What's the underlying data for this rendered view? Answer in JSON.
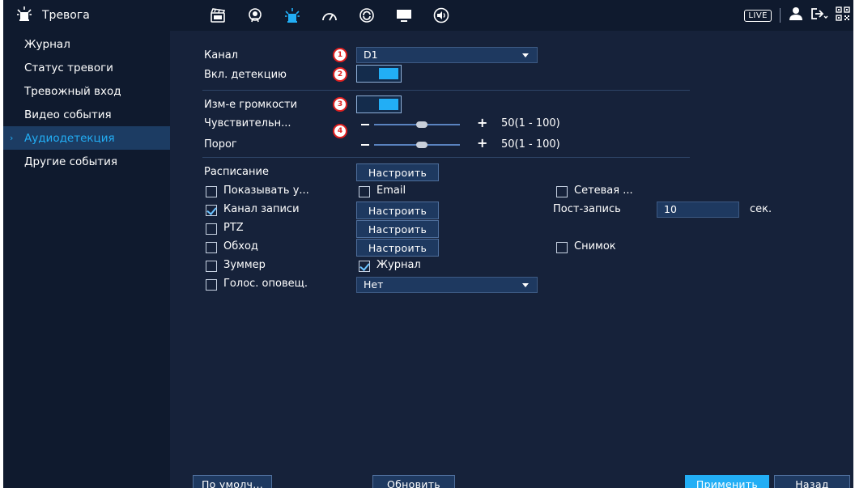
{
  "header": {
    "title": "Тревога",
    "live_label": "LIVE",
    "icons": [
      "alarm-light-icon",
      "film-icon",
      "face-ai-icon",
      "alarm-icon",
      "gauge-icon",
      "refresh-icon",
      "monitor-icon",
      "speaker-icon",
      "user-icon",
      "logout-icon",
      "qr-code-icon"
    ]
  },
  "sidebar": {
    "items": [
      {
        "label": "Журнал",
        "active": false
      },
      {
        "label": "Статус тревоги",
        "active": false
      },
      {
        "label": "Тревожный вход",
        "active": false
      },
      {
        "label": "Видео события",
        "active": false
      },
      {
        "label": "Аудиодетекция",
        "active": true
      },
      {
        "label": "Другие события",
        "active": false
      }
    ]
  },
  "form": {
    "channel_label": "Канал",
    "channel_value": "D1",
    "enable_detection_label": "Вкл. детекцию",
    "enable_detection_on": true,
    "volume_change_label": "Изм-е громкости",
    "volume_change_on": true,
    "sensitivity_label": "Чувствительн...",
    "sensitivity_value": "50(1 - 100)",
    "sensitivity_level": 50,
    "threshold_label": "Порог",
    "threshold_value": "50(1 - 100)",
    "threshold_level": 50,
    "badges": [
      "1",
      "2",
      "3",
      "4"
    ],
    "schedule_label": "Расписание",
    "configure_label": "Настроить",
    "show_message_label": "Показывать у...",
    "email_label": "Email",
    "network_label": "Сетевая ...",
    "record_channel_label": "Канал записи",
    "post_record_label": "Пост-запись",
    "post_record_value": "10",
    "post_record_unit": "сек.",
    "ptz_label": "PTZ",
    "tour_label": "Обход",
    "snapshot_label": "Снимок",
    "buzzer_label": "Зуммер",
    "log_label": "Журнал",
    "voice_label": "Голос. оповещ.",
    "voice_value": "Нет"
  },
  "footer": {
    "default_label": "По умолч...",
    "refresh_label": "Обновить",
    "apply_label": "Применить",
    "back_label": "Назад"
  },
  "colors": {
    "accent": "#22aef5",
    "panel_bg": "#16223a",
    "sidebar_bg": "#0f1a2e",
    "badge_red": "#e02020"
  }
}
